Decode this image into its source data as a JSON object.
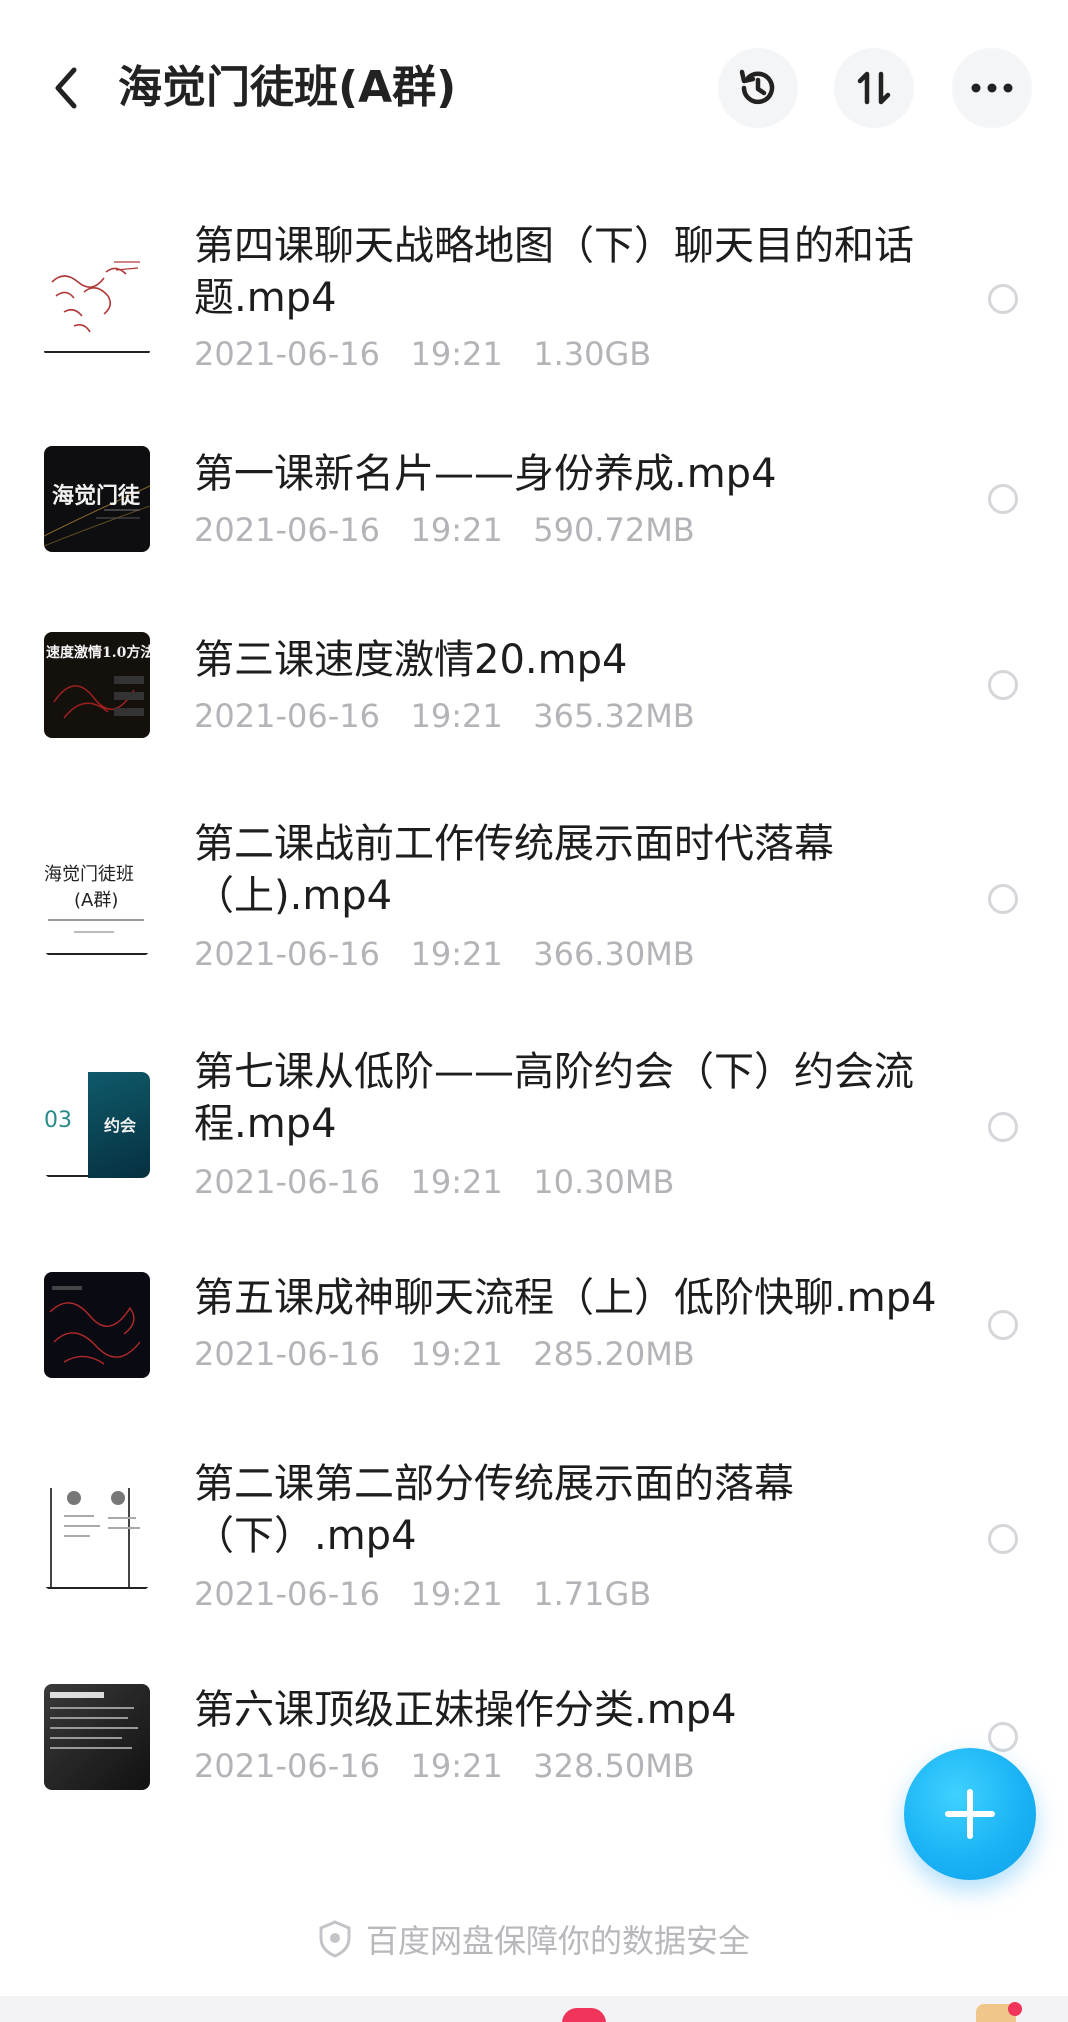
{
  "header": {
    "title": "海觉门徒班(A群)",
    "back_icon": "chevron-left-icon",
    "history_icon": "history-icon",
    "sort_icon": "sort-icon",
    "more_icon": "more-icon"
  },
  "files": [
    {
      "name": "第四课聊天战略地图（下）聊天目的和话题.mp4",
      "date": "2021-06-16",
      "time": "19:21",
      "size": "1.30GB",
      "thumb": "handwriting-thumbnail"
    },
    {
      "name": "第一课新名片——身份养成.mp4",
      "date": "2021-06-16",
      "time": "19:21",
      "size": "590.72MB",
      "thumb": "dark-title-thumbnail",
      "thumb_text": "海觉门徒"
    },
    {
      "name": "第三课速度激情20.mp4",
      "date": "2021-06-16",
      "time": "19:21",
      "size": "365.32MB",
      "thumb": "dark-slide-thumbnail",
      "thumb_text": "速度激情1.0方法"
    },
    {
      "name": "第二课战前工作传统展示面时代落幕（上).mp4",
      "date": "2021-06-16",
      "time": "19:21",
      "size": "366.30MB",
      "thumb": "white-title-thumbnail",
      "thumb_text_1": "海觉门徒班",
      "thumb_text_2": "(A群)"
    },
    {
      "name": "第七课从低阶——高阶约会（下）约会流程.mp4",
      "date": "2021-06-16",
      "time": "19:21",
      "size": "10.30MB",
      "thumb": "teal-slide-thumbnail",
      "thumb_text_1": "03",
      "thumb_text_2": "约会"
    },
    {
      "name": "第五课成神聊天流程（上）低阶快聊.mp4",
      "date": "2021-06-16",
      "time": "19:21",
      "size": "285.20MB",
      "thumb": "dark-scribble-thumbnail"
    },
    {
      "name": "第二课第二部分传统展示面的落幕（下）.mp4",
      "date": "2021-06-16",
      "time": "19:21",
      "size": "1.71GB",
      "thumb": "diagram-thumbnail"
    },
    {
      "name": "第六课顶级正妹操作分类.mp4",
      "date": "2021-06-16",
      "time": "19:21",
      "size": "328.50MB",
      "thumb": "gray-slide-thumbnail"
    }
  ],
  "fab": {
    "icon": "plus-icon"
  },
  "footer": {
    "note": "百度网盘保障你的数据安全",
    "icon": "shield-icon"
  },
  "colors": {
    "accent": "#1ab3f5",
    "meta_text": "#b4b4b8",
    "badge": "#f0345a"
  }
}
